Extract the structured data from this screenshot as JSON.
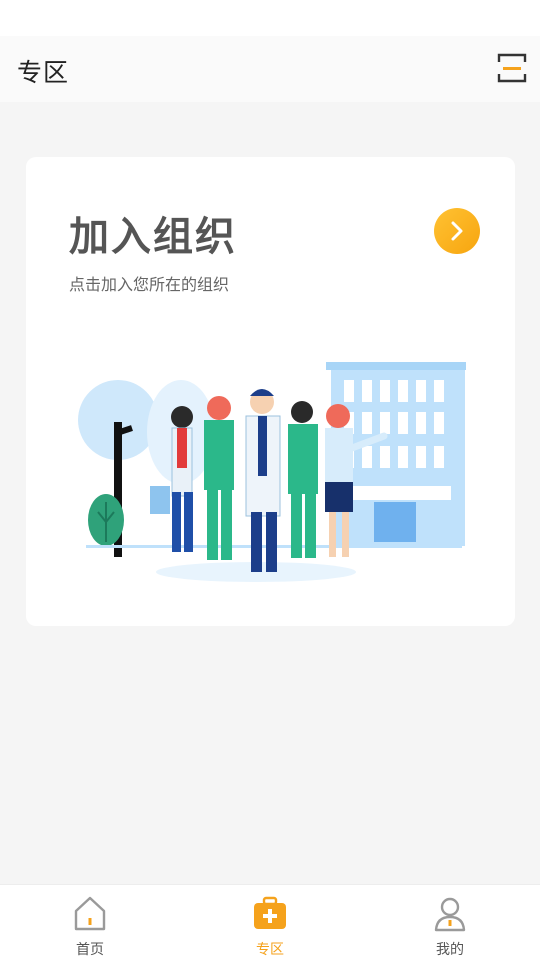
{
  "header": {
    "title": "专区"
  },
  "card": {
    "title": "加入组织",
    "subtitle": "点击加入您所在的组织"
  },
  "tabs": [
    {
      "label": "首页",
      "icon": "home-icon",
      "active": false
    },
    {
      "label": "专区",
      "icon": "medical-kit-icon",
      "active": true
    },
    {
      "label": "我的",
      "icon": "profile-icon",
      "active": false
    }
  ],
  "colors": {
    "accent": "#f5a21c",
    "medical_green": "#2bb88a",
    "sky_blue": "#bfe1fb"
  }
}
